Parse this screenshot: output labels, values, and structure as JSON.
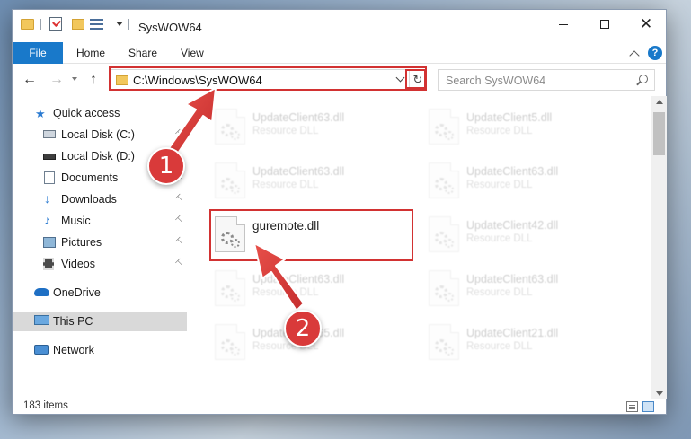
{
  "window": {
    "title": "SysWOW64",
    "minimize_glyph": "",
    "maximize_glyph": "",
    "close_glyph": "✕"
  },
  "ribbon": {
    "tabs": [
      "File",
      "Home",
      "Share",
      "View"
    ],
    "help_glyph": "?"
  },
  "nav": {
    "back_glyph": "←",
    "forward_glyph": "→",
    "up_glyph": "↑",
    "address": "C:\\Windows\\SysWOW64",
    "refresh_glyph": "↻",
    "search_placeholder": "Search SysWOW64"
  },
  "sidebar": {
    "items": [
      {
        "label": "Quick access",
        "icon": "star-icon"
      },
      {
        "label": "Local Disk (C:)",
        "icon": "drive-icon"
      },
      {
        "label": "Local Disk (D:)",
        "icon": "drive-icon"
      },
      {
        "label": "Documents",
        "icon": "documents-icon"
      },
      {
        "label": "Downloads",
        "icon": "download-icon"
      },
      {
        "label": "Music",
        "icon": "music-icon"
      },
      {
        "label": "Pictures",
        "icon": "pictures-icon"
      },
      {
        "label": "Videos",
        "icon": "videos-icon"
      },
      {
        "label": "OneDrive",
        "icon": "cloud-icon"
      },
      {
        "label": "This PC",
        "icon": "computer-icon"
      },
      {
        "label": "Network",
        "icon": "network-icon"
      }
    ],
    "pin_glyph": "📌"
  },
  "files": {
    "left": [
      {
        "name": "UpdateClient63.dll",
        "type": "Resource DLL"
      },
      {
        "name": "UpdateClient63.dll",
        "type": "Resource DLL"
      },
      {
        "name": "guremote.dll",
        "type": ""
      },
      {
        "name": "UpdateClient63.dll",
        "type": "Resource DLL"
      },
      {
        "name": "UpdateClient65.dll",
        "type": "Resource DLL"
      }
    ],
    "right": [
      {
        "name": "UpdateClient5.dll",
        "type": "Resource DLL"
      },
      {
        "name": "UpdateClient63.dll",
        "type": "Resource DLL"
      },
      {
        "name": "UpdateClient42.dll",
        "type": "Resource DLL"
      },
      {
        "name": "UpdateClient63.dll",
        "type": "Resource DLL"
      },
      {
        "name": "UpdateClient21.dll",
        "type": "Resource DLL"
      }
    ]
  },
  "status": {
    "item_count": "183 items"
  },
  "annotations": {
    "step1": "1",
    "step2": "2",
    "accent_color": "#d93a3a"
  }
}
